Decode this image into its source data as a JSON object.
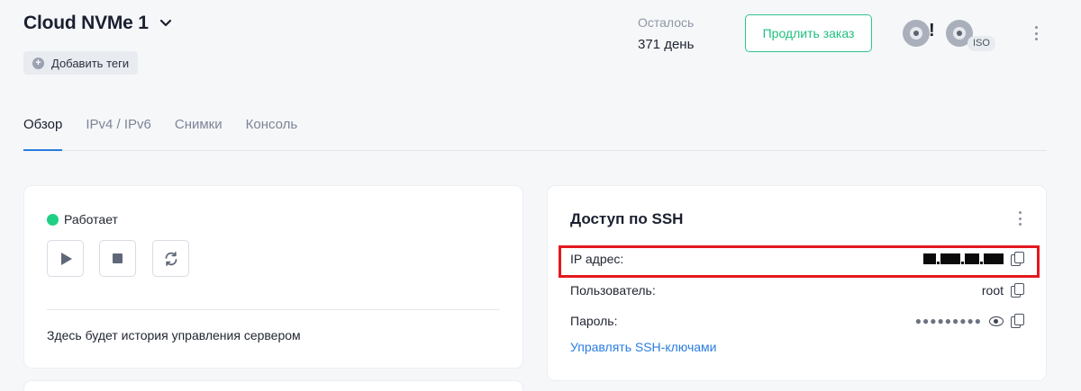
{
  "header": {
    "title": "Cloud NVMe 1",
    "add_tags_label": "Добавить теги",
    "remaining_label": "Осталось",
    "remaining_value": "371 день",
    "renew_label": "Продлить заказ",
    "disc_alert_mark": "!",
    "iso_badge": "ISO"
  },
  "tabs": [
    {
      "label": "Обзор",
      "active": true
    },
    {
      "label": "IPv4 / IPv6",
      "active": false
    },
    {
      "label": "Снимки",
      "active": false
    },
    {
      "label": "Консоль",
      "active": false
    }
  ],
  "server_card": {
    "status_text": "Работает",
    "status_color": "#1fcf83",
    "history_text": "Здесь будет история управления сервером"
  },
  "ssh_card": {
    "title": "Доступ по SSH",
    "ip_label": "IP адрес:",
    "user_label": "Пользователь:",
    "user_value": "root",
    "password_label": "Пароль:",
    "password_mask": "●●●●●●●●●",
    "manage_keys_label": "Управлять SSH-ключами"
  },
  "colors": {
    "accent_green": "#1fbf7e",
    "link_blue": "#2a7de1",
    "highlight_red": "#e3191f"
  }
}
